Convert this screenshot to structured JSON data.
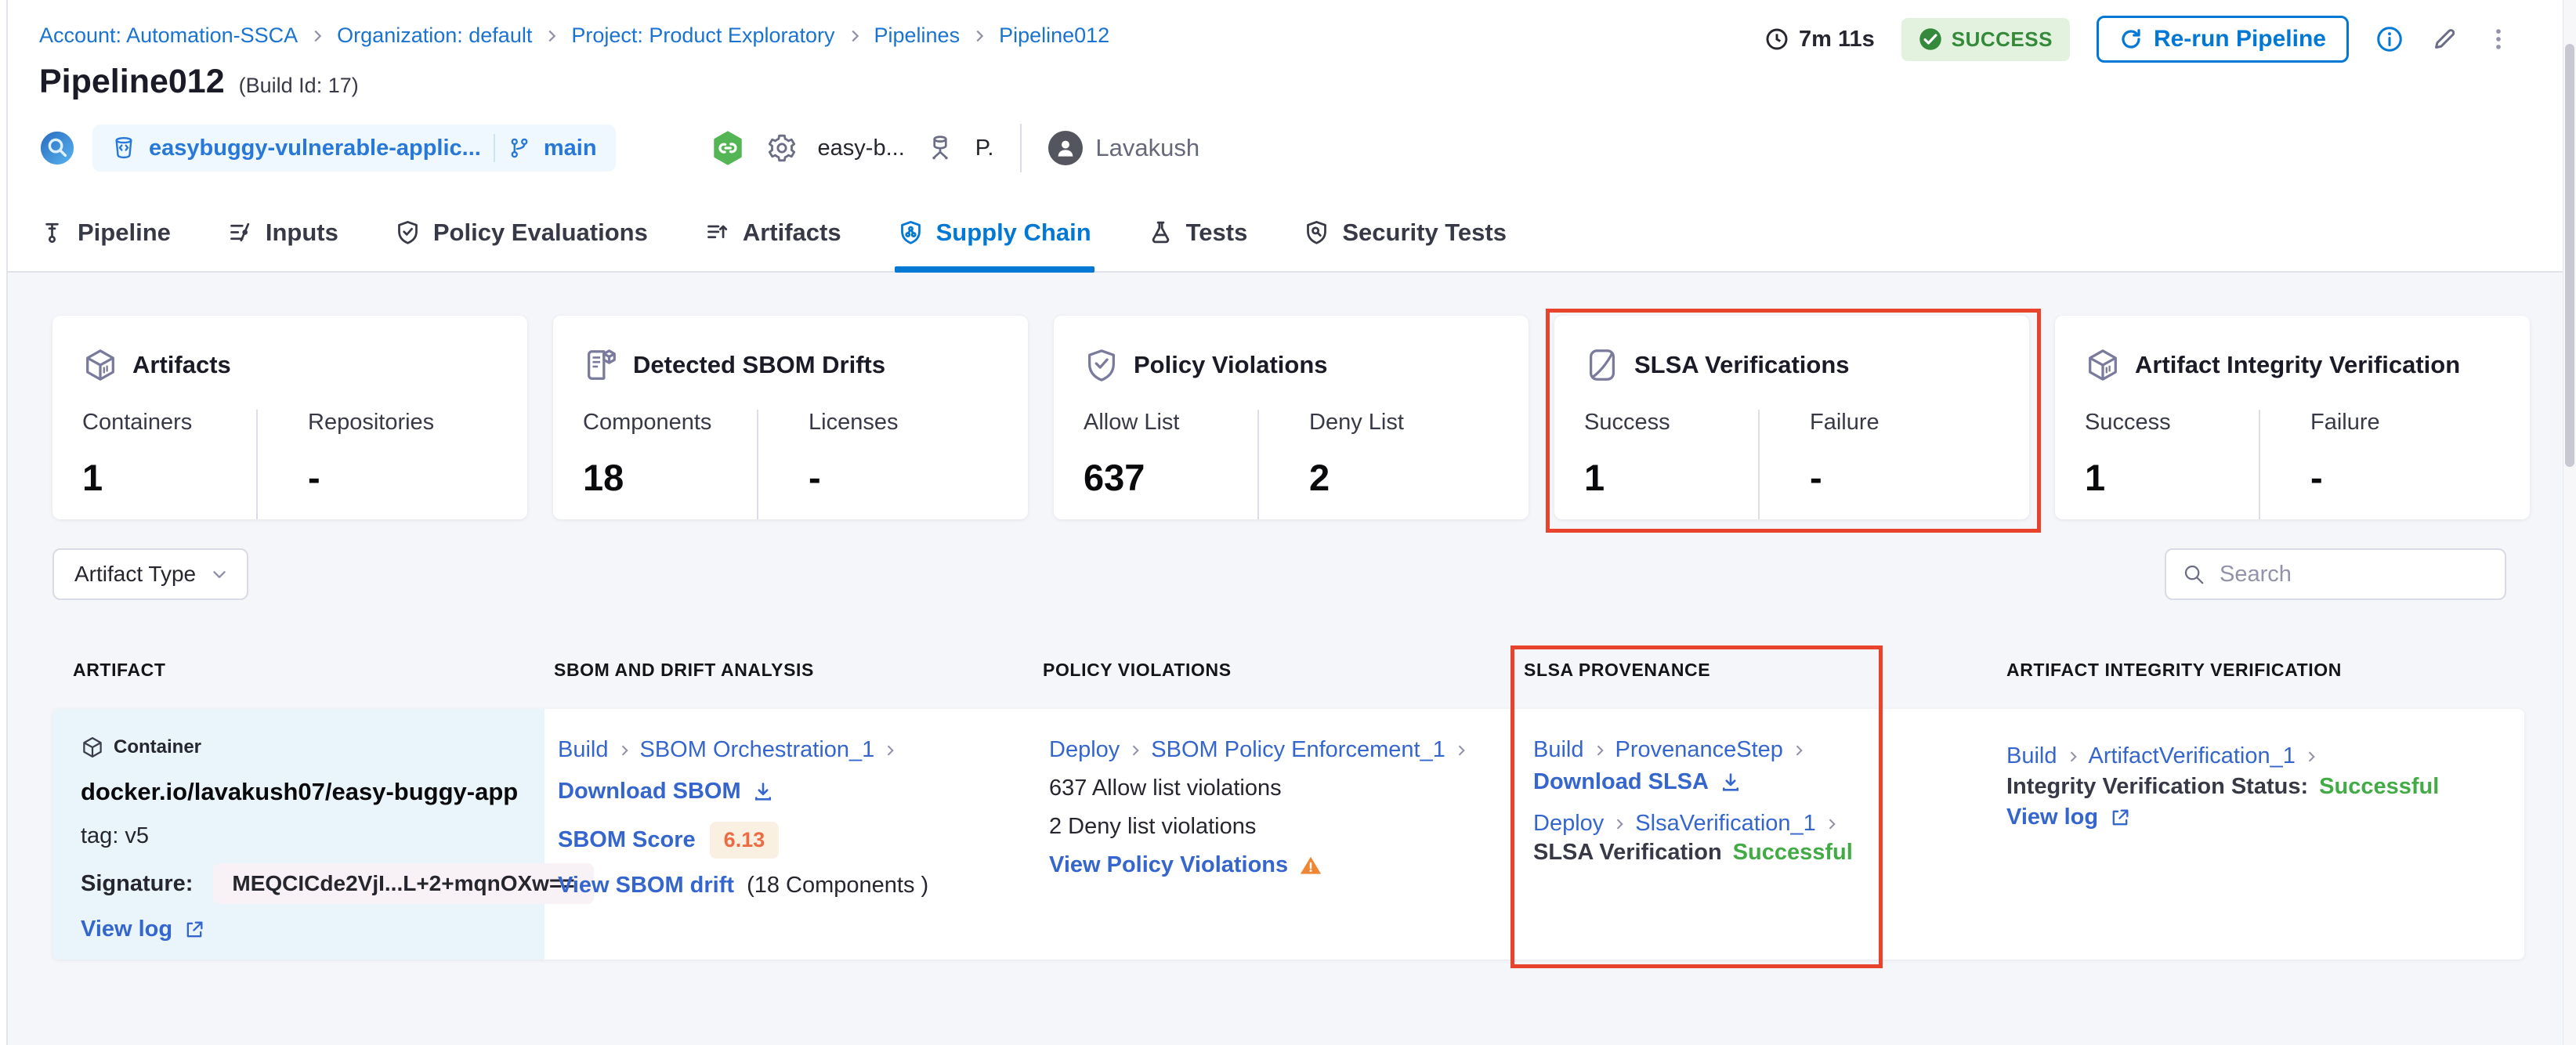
{
  "colors": {
    "primary_blue": "#0278d5",
    "link_blue": "#3566cd",
    "highlight_red": "#e8432c",
    "success_green": "#42ab45",
    "badge_green_bg": "#e3f2df",
    "badge_green_text": "#348a3a",
    "score_orange": "#ed6b42",
    "warning_orange": "#ef8633",
    "artifact_cell_bg": "#e9f5fb"
  },
  "breadcrumb": {
    "items": [
      "Account: Automation-SSCA",
      "Organization: default",
      "Project: Product Exploratory",
      "Pipelines",
      "Pipeline012"
    ]
  },
  "header": {
    "title": "Pipeline012",
    "build_id": "(Build Id: 17)",
    "duration": "7m 11s",
    "status": "SUCCESS",
    "rerun_label": "Re-run Pipeline",
    "repo": "easybuggy-vulnerable-applic...",
    "branch": "main",
    "trigger_label": "easy-b...",
    "trigger_owner": "P.",
    "user": "Lavakush"
  },
  "tabs": [
    {
      "label": "Pipeline"
    },
    {
      "label": "Inputs"
    },
    {
      "label": "Policy Evaluations"
    },
    {
      "label": "Artifacts"
    },
    {
      "label": "Supply Chain",
      "active": true
    },
    {
      "label": "Tests"
    },
    {
      "label": "Security Tests"
    }
  ],
  "cards": [
    {
      "title": "Artifacts",
      "metrics": [
        {
          "label": "Containers",
          "value": "1"
        },
        {
          "label": "Repositories",
          "value": "-"
        }
      ]
    },
    {
      "title": "Detected SBOM Drifts",
      "metrics": [
        {
          "label": "Components",
          "value": "18"
        },
        {
          "label": "Licenses",
          "value": "-"
        }
      ]
    },
    {
      "title": "Policy Violations",
      "metrics": [
        {
          "label": "Allow List",
          "value": "637"
        },
        {
          "label": "Deny List",
          "value": "2"
        }
      ]
    },
    {
      "title": "SLSA Verifications",
      "highlighted": true,
      "metrics": [
        {
          "label": "Success",
          "value": "1"
        },
        {
          "label": "Failure",
          "value": "-"
        }
      ]
    },
    {
      "title": "Artifact Integrity Verification",
      "metrics": [
        {
          "label": "Success",
          "value": "1"
        },
        {
          "label": "Failure",
          "value": "-"
        }
      ]
    }
  ],
  "filters": {
    "artifact_type_label": "Artifact Type",
    "search_placeholder": "Search"
  },
  "table": {
    "columns": [
      "ARTIFACT",
      "SBOM AND DRIFT ANALYSIS",
      "POLICY VIOLATIONS",
      "SLSA PROVENANCE",
      "ARTIFACT INTEGRITY VERIFICATION"
    ],
    "row": {
      "artifact": {
        "type_badge": "Container",
        "image": "docker.io/lavakush07/easy-buggy-app",
        "tag": "tag: v5",
        "signature_label": "Signature:",
        "signature_value": "MEQCICde2VjI...L+2+mqnOXw==",
        "view_log": "View log"
      },
      "sbom": {
        "stage": "Build",
        "step": "SBOM Orchestration_1",
        "download": "Download SBOM",
        "score_label": "SBOM Score",
        "score": "6.13",
        "drift_link": "View SBOM drift",
        "drift_suffix": "(18 Components )"
      },
      "policy": {
        "stage": "Deploy",
        "step": "SBOM Policy Enforcement_1",
        "allow": "637 Allow list violations",
        "deny": "2 Deny list violations",
        "view": "View Policy Violations"
      },
      "slsa": {
        "stage1": "Build",
        "step1": "ProvenanceStep",
        "download": "Download SLSA",
        "stage2": "Deploy",
        "step2": "SlsaVerification_1",
        "status_label": "SLSA Verification",
        "status_value": "Successful"
      },
      "integrity": {
        "stage": "Build",
        "step": "ArtifactVerification_1",
        "status_label": "Integrity Verification Status:",
        "status_value": "Successful",
        "view_log": "View log"
      }
    }
  }
}
